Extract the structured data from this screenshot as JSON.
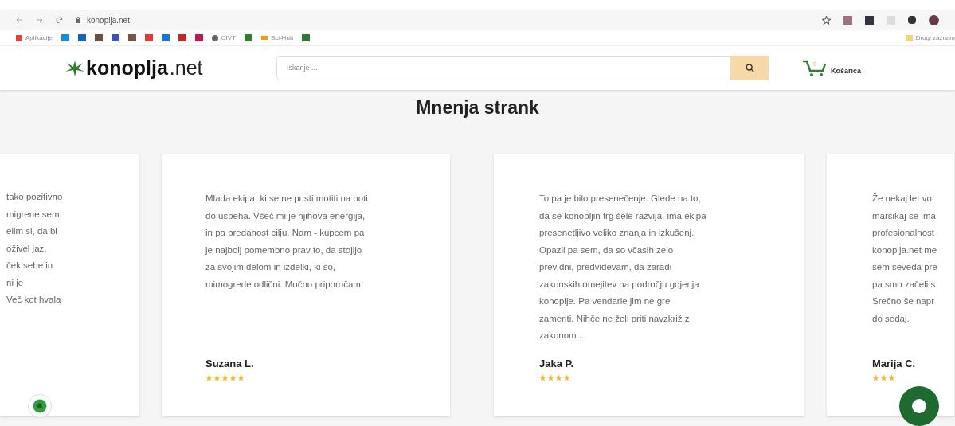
{
  "browser": {
    "url": "konoplja.net",
    "bookmarks": [
      {
        "kind": "apps",
        "label": "Aplikacije"
      },
      {
        "kind": "icon"
      },
      {
        "kind": "icon"
      },
      {
        "kind": "icon"
      },
      {
        "kind": "icon"
      },
      {
        "kind": "icon"
      },
      {
        "kind": "icon"
      },
      {
        "kind": "icon"
      },
      {
        "kind": "icon"
      },
      {
        "kind": "icon"
      },
      {
        "kind": "globe",
        "label": "CIVT"
      },
      {
        "kind": "icon"
      },
      {
        "kind": "link",
        "label": "Sci-Hub"
      },
      {
        "kind": "icon"
      }
    ],
    "other_bookmarks": "Drugi zaznam"
  },
  "header": {
    "logo_bold": "konoplja",
    "logo_rest": ".net",
    "search": {
      "placeholder": "Iskanje ..."
    },
    "cart": {
      "count": "0",
      "label": "Košarica"
    }
  },
  "section": {
    "title": "Mnenja strank"
  },
  "reviews": [
    {
      "lines": [
        "tako pozitivno",
        "migrene sem",
        "elim si, da bi",
        "oživel jaz.",
        "ček sebe in",
        "ni je",
        "Več kot hvala"
      ]
    },
    {
      "lines": [
        "Mlada ekipa, ki se ne pusti motiti na poti",
        "do uspeha. Všeč mi je njihova energija,",
        "in pa predanost cilju. Nam - kupcem pa",
        "je najbolj pomembno prav to, da stojijo",
        "za svojim delom in izdelki, ki so,",
        "mimogrede odlični. Močno priporočam!"
      ],
      "name": "Suzana L.",
      "stars": 5
    },
    {
      "lines": [
        "To pa je bilo presenečenje. Glede na to,",
        "da se konopljin trg šele razvija, ima ekipa",
        "presenetljivo veliko znanja in izkušenj.",
        "Opazil pa sem, da so včasih zelo",
        "previdni, predvidevam, da zaradi",
        "zakonskih omejitev na področju gojenja",
        "konoplje. Pa vendarle jim ne gre",
        "zameriti. Nihče ne želi priti navzkriž z",
        "zakonom ..."
      ],
      "name": "Jaka P.",
      "stars": 4
    },
    {
      "lines": [
        "Že nekaj let vo",
        "marsikaj se ima",
        "profesionalnost",
        "konoplja.net me",
        "sem seveda pre",
        "pa smo začeli s",
        "Srečno še napr",
        "do sedaj."
      ],
      "name": "Marija C.",
      "stars": 3
    }
  ]
}
